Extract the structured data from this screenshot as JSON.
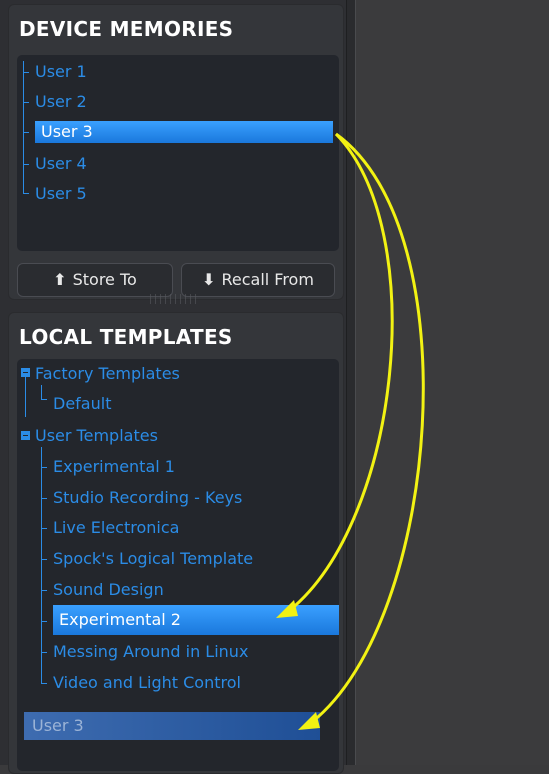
{
  "device_memories": {
    "title": "DEVICE MEMORIES",
    "items": [
      "User 1",
      "User 2",
      "User 3",
      "User 4",
      "User 5"
    ],
    "selected": "User 3",
    "store_button": "Store To",
    "recall_button": "Recall From"
  },
  "local_templates": {
    "title": "LOCAL TEMPLATES",
    "factory_group": "Factory Templates",
    "factory_items": [
      "Default"
    ],
    "user_group": "User Templates",
    "user_items": [
      "Experimental 1",
      "Studio Recording - Keys",
      "Live Electronica",
      "Spock's Logical Template",
      "Sound Design",
      "Experimental 2",
      "Messing Around in Linux",
      "Video and Light Control"
    ],
    "selected": "Experimental 2",
    "drop_item": "User 3"
  },
  "colors": {
    "accent": "#2b8ce6",
    "selection": "#1a78dc",
    "arrow": "#f2f213"
  }
}
